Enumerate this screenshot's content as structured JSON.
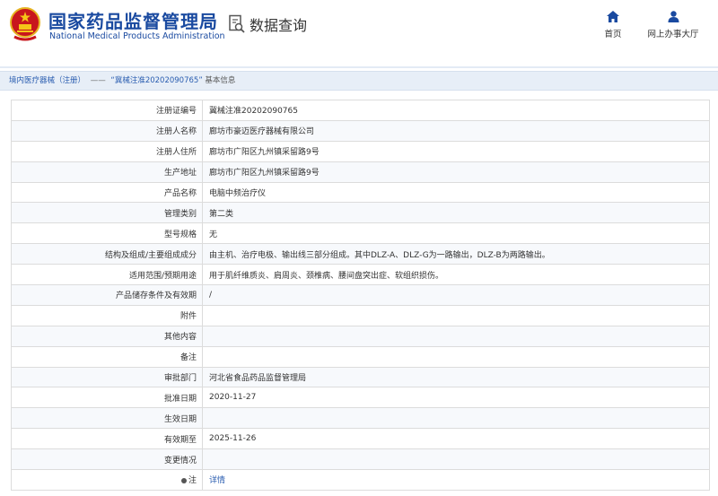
{
  "header": {
    "brand_cn": "国家药品监督管理局",
    "brand_en": "National Medical Products Administration",
    "query_label": "数据查询",
    "nav": {
      "home": "首页",
      "hall": "网上办事大厅"
    }
  },
  "breadcrumb": {
    "category": "境内医疗器械（注册）",
    "separator": "——",
    "record": "“冀械注准20202090765”",
    "page": "基本信息"
  },
  "colors": {
    "brand_blue": "#1a4aa0",
    "link_blue": "#2a5db0",
    "breadcrumb_bg": "#e7eef7"
  },
  "rows": [
    {
      "label": "注册证编号",
      "value": "冀械注准20202090765"
    },
    {
      "label": "注册人名称",
      "value": "廊坊市豪迈医疗器械有限公司"
    },
    {
      "label": "注册人住所",
      "value": "廊坊市广阳区九州镇采留路9号"
    },
    {
      "label": "生产地址",
      "value": "廊坊市广阳区九州镇采留路9号"
    },
    {
      "label": "产品名称",
      "value": "电脑中频治疗仪"
    },
    {
      "label": "管理类别",
      "value": "第二类"
    },
    {
      "label": "型号规格",
      "value": "无"
    },
    {
      "label": "结构及组成/主要组成成分",
      "value": "由主机、治疗电极、输出线三部分组成。其中DLZ-A、DLZ-G为一路输出，DLZ-B为两路输出。"
    },
    {
      "label": "适用范围/预期用途",
      "value": "用于肌纤维质炎、肩周炎、颈椎病、腰间盘突出症、软组织损伤。"
    },
    {
      "label": "产品储存条件及有效期",
      "value": "/"
    },
    {
      "label": "附件",
      "value": ""
    },
    {
      "label": "其他内容",
      "value": ""
    },
    {
      "label": "备注",
      "value": ""
    },
    {
      "label": "审批部门",
      "value": "河北省食品药品监督管理局"
    },
    {
      "label": "批准日期",
      "value": "2020-11-27"
    },
    {
      "label": "生效日期",
      "value": ""
    },
    {
      "label": "有效期至",
      "value": "2025-11-26"
    },
    {
      "label": "变更情况",
      "value": ""
    },
    {
      "label": "注",
      "value": "详情"
    }
  ]
}
